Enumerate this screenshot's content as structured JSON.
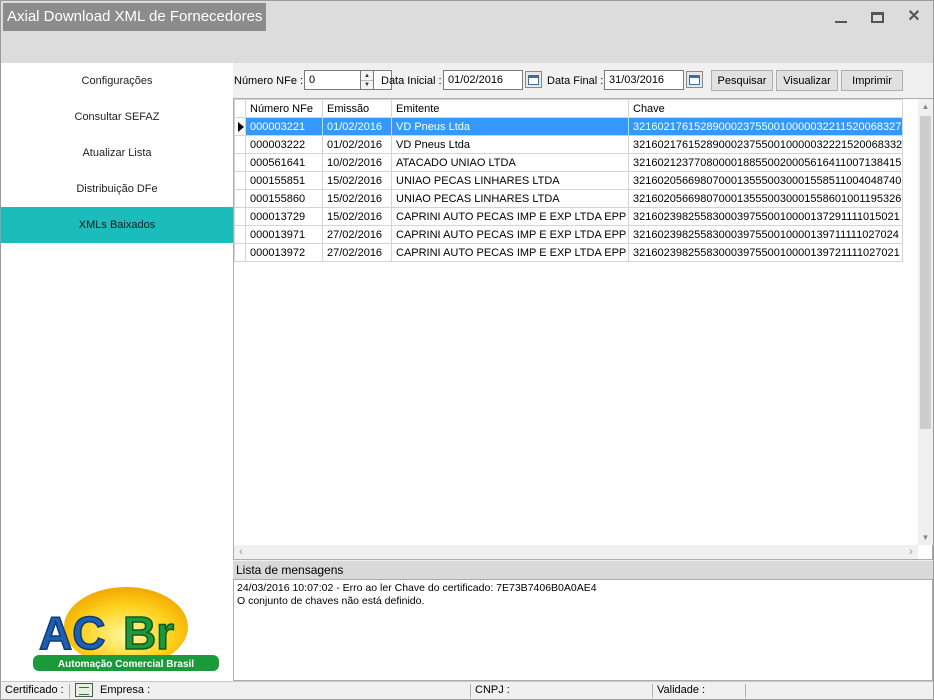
{
  "window": {
    "title": "Axial Download XML de Fornecedores"
  },
  "sidebar": {
    "items": [
      {
        "label": "Configurações"
      },
      {
        "label": "Consultar SEFAZ"
      },
      {
        "label": "Atualizar Lista"
      },
      {
        "label": "Distribuição DFe"
      },
      {
        "label": "XMLs Baixados",
        "active": true
      }
    ],
    "accent_color": "#1abcbc"
  },
  "logo": {
    "text": "ACBr",
    "tagline": "Automação Comercial Brasil"
  },
  "filters": {
    "numero_label": "Número NFe :",
    "numero_value": "0",
    "data_inicial_label": "Data Inicial :",
    "data_inicial_value": "01/02/2016",
    "data_final_label": "Data Final :",
    "data_final_value": "31/03/2016",
    "pesquisar_label": "Pesquisar",
    "visualizar_label": "Visualizar",
    "imprimir_label": "Imprimir"
  },
  "grid": {
    "columns": [
      "Número NFe",
      "Emissão",
      "Emitente",
      "Chave"
    ],
    "rows": [
      [
        "000003221",
        "01/02/2016",
        "VD Pneus Ltda",
        "32160217615289000237550010000032211520068327"
      ],
      [
        "000003222",
        "01/02/2016",
        "VD Pneus Ltda",
        "32160217615289000237550010000032221520068332"
      ],
      [
        "000561641",
        "10/02/2016",
        "ATACADO UNIAO LTDA",
        "32160212377080000188550020005616411007138415"
      ],
      [
        "000155851",
        "15/02/2016",
        "UNIAO PECAS LINHARES LTDA",
        "32160205669807000135550030001558511004048740"
      ],
      [
        "000155860",
        "15/02/2016",
        "UNIAO PECAS LINHARES LTDA",
        "32160205669807000135550030001558601001195326"
      ],
      [
        "000013729",
        "15/02/2016",
        "CAPRINI AUTO PECAS IMP E EXP LTDA EPP",
        "32160239825583000397550010000137291111015021"
      ],
      [
        "000013971",
        "27/02/2016",
        "CAPRINI AUTO PECAS IMP E EXP LTDA EPP",
        "32160239825583000397550010000139711111027024"
      ],
      [
        "000013972",
        "27/02/2016",
        "CAPRINI AUTO PECAS IMP E EXP LTDA EPP",
        "32160239825583000397550010000139721111027021"
      ]
    ],
    "selected_row": 0,
    "selection_color": "#3399ff"
  },
  "messages": {
    "header": "Lista de mensagens",
    "lines": [
      "24/03/2016 10:07:02 - Erro ao ler Chave do certificado: 7E73B7406B0A0AE4",
      "O conjunto de chaves não está definido."
    ]
  },
  "statusbar": {
    "certificado_label": "Certificado :",
    "empresa_label": "Empresa :",
    "cnpj_label": "CNPJ :",
    "validade_label": "Validade :"
  }
}
